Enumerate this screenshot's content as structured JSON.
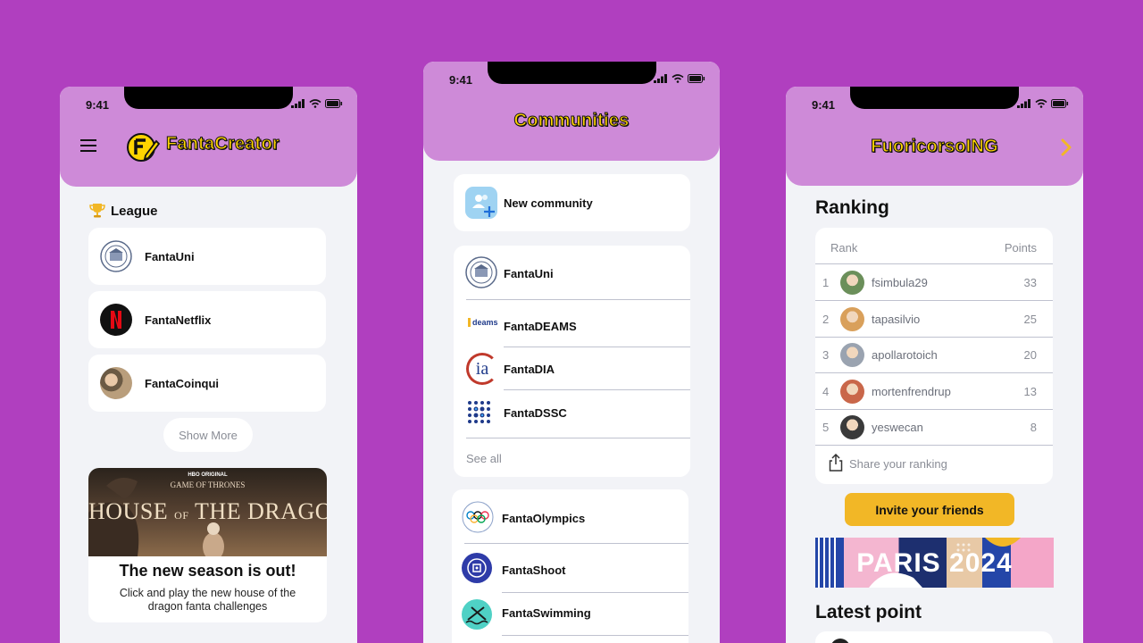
{
  "status": {
    "time": "9:41"
  },
  "screen1": {
    "app_title": "FantaCreator",
    "section_title": "League",
    "leagues": [
      "FantaUni",
      "FantaNetflix",
      "FantaCoinqui"
    ],
    "show_more": "Show More",
    "promo": {
      "hbo": "HBO ORIGINAL",
      "got": "GAME OF THRONES",
      "hotd_line1": "HOUSE",
      "hotd_of": "OF",
      "hotd_line2": "THE DRAGON",
      "headline": "The new season is out!",
      "body": "Click and play the new house of the dragon fanta challenges"
    }
  },
  "screen2": {
    "title": "Communities",
    "new_community": "New community",
    "group1": [
      "FantaUni",
      "FantaDEAMS",
      "FantaDIA",
      "FantaDSSC"
    ],
    "deams_logo": "deams",
    "dia_logo": "ia",
    "see_all": "See all",
    "group2": [
      "FantaOlympics",
      "FantaShoot",
      "FantaSwimming"
    ]
  },
  "screen3": {
    "title": "FuoricorsoING",
    "ranking_title": "Ranking",
    "col_rank": "Rank",
    "col_points": "Points",
    "rows": [
      {
        "rank": "1",
        "name": "fsimbula29",
        "points": "33"
      },
      {
        "rank": "2",
        "name": "tapasilvio",
        "points": "25"
      },
      {
        "rank": "3",
        "name": "apollarotoich",
        "points": "20"
      },
      {
        "rank": "4",
        "name": "mortenfrendrup",
        "points": "13"
      },
      {
        "rank": "5",
        "name": "yeswecan",
        "points": "8"
      }
    ],
    "share": "Share your ranking",
    "invite": "Invite your friends",
    "banner": "PARIS 2024",
    "latest_title": "Latest point"
  },
  "colors": {
    "background": "#B03FBF",
    "header": "#CE8AD8",
    "accent_yellow": "#FFD400",
    "invite_button": "#F2B726"
  }
}
